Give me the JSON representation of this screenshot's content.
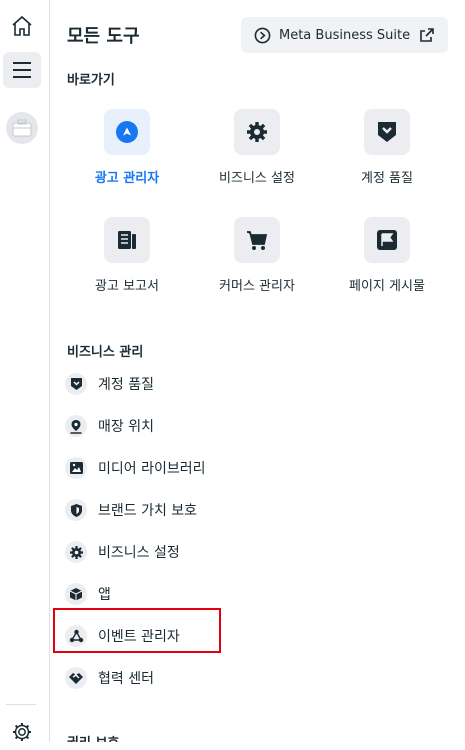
{
  "panel": {
    "title": "모든 도구",
    "mbs_button": "Meta Business Suite"
  },
  "shortcuts": {
    "title": "바로가기",
    "items": [
      {
        "label": "광고 관리자"
      },
      {
        "label": "비즈니스 설정"
      },
      {
        "label": "계정 품질"
      },
      {
        "label": "광고 보고서"
      },
      {
        "label": "커머스 관리자"
      },
      {
        "label": "페이지 게시물"
      }
    ]
  },
  "business": {
    "title": "비즈니스 관리",
    "items": [
      {
        "label": "계정 품질"
      },
      {
        "label": "매장 위치"
      },
      {
        "label": "미디어 라이브러리"
      },
      {
        "label": "브랜드 가치 보호"
      },
      {
        "label": "비즈니스 설정"
      },
      {
        "label": "앱"
      },
      {
        "label": "이벤트 관리자"
      },
      {
        "label": "협력 센터"
      }
    ]
  },
  "rights": {
    "title": "권리 보호"
  },
  "colors": {
    "accent": "#1877f2",
    "highlight": "#e0000f"
  }
}
